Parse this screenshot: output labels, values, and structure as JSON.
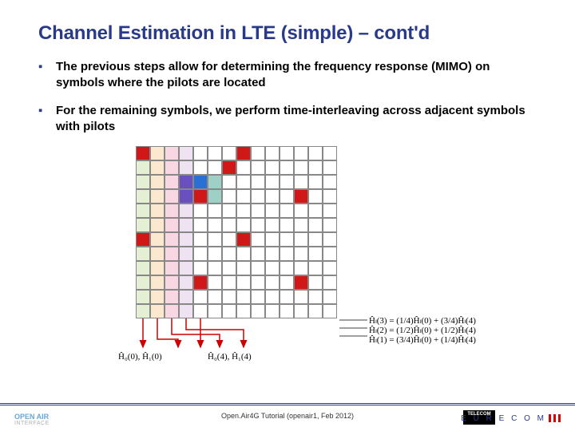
{
  "title": "Channel Estimation in LTE (simple) – cont'd",
  "bullets": [
    "The previous steps allow for determining the frequency response (MIMO) on symbols where the pilots are located",
    "For the remaining symbols, we perform time-interleaving across adjacent symbols with pilots"
  ],
  "grid": {
    "cols": 14,
    "rows": 12,
    "shaded_cols_lightpastels": true,
    "cells": [
      {
        "r": 0,
        "c": 0,
        "color": "#e4f0d4"
      },
      {
        "r": 1,
        "c": 0,
        "color": "#e4f0d4"
      },
      {
        "r": 2,
        "c": 0,
        "color": "#e4f0d4"
      },
      {
        "r": 3,
        "c": 0,
        "color": "#e4f0d4"
      },
      {
        "r": 4,
        "c": 0,
        "color": "#e4f0d4"
      },
      {
        "r": 5,
        "c": 0,
        "color": "#e4f0d4"
      },
      {
        "r": 6,
        "c": 0,
        "color": "#e4f0d4"
      },
      {
        "r": 7,
        "c": 0,
        "color": "#e4f0d4"
      },
      {
        "r": 8,
        "c": 0,
        "color": "#e4f0d4"
      },
      {
        "r": 9,
        "c": 0,
        "color": "#e4f0d4"
      },
      {
        "r": 10,
        "c": 0,
        "color": "#e4f0d4"
      },
      {
        "r": 11,
        "c": 0,
        "color": "#e4f0d4"
      },
      {
        "r": 0,
        "c": 1,
        "color": "#fbe8cf"
      },
      {
        "r": 1,
        "c": 1,
        "color": "#fbe8cf"
      },
      {
        "r": 2,
        "c": 1,
        "color": "#fbe8cf"
      },
      {
        "r": 3,
        "c": 1,
        "color": "#fbe8cf"
      },
      {
        "r": 4,
        "c": 1,
        "color": "#fbe8cf"
      },
      {
        "r": 5,
        "c": 1,
        "color": "#fbe8cf"
      },
      {
        "r": 6,
        "c": 1,
        "color": "#fbe8cf"
      },
      {
        "r": 7,
        "c": 1,
        "color": "#fbe8cf"
      },
      {
        "r": 8,
        "c": 1,
        "color": "#fbe8cf"
      },
      {
        "r": 9,
        "c": 1,
        "color": "#fbe8cf"
      },
      {
        "r": 10,
        "c": 1,
        "color": "#fbe8cf"
      },
      {
        "r": 11,
        "c": 1,
        "color": "#fbe8cf"
      },
      {
        "r": 0,
        "c": 2,
        "color": "#f9d7e2"
      },
      {
        "r": 1,
        "c": 2,
        "color": "#f9d7e2"
      },
      {
        "r": 2,
        "c": 2,
        "color": "#f9d7e2"
      },
      {
        "r": 3,
        "c": 2,
        "color": "#f9d7e2"
      },
      {
        "r": 4,
        "c": 2,
        "color": "#f9d7e2"
      },
      {
        "r": 5,
        "c": 2,
        "color": "#f9d7e2"
      },
      {
        "r": 6,
        "c": 2,
        "color": "#f9d7e2"
      },
      {
        "r": 7,
        "c": 2,
        "color": "#f9d7e2"
      },
      {
        "r": 8,
        "c": 2,
        "color": "#f9d7e2"
      },
      {
        "r": 9,
        "c": 2,
        "color": "#f9d7e2"
      },
      {
        "r": 10,
        "c": 2,
        "color": "#f9d7e2"
      },
      {
        "r": 11,
        "c": 2,
        "color": "#f9d7e2"
      },
      {
        "r": 0,
        "c": 3,
        "color": "#efe2f2"
      },
      {
        "r": 1,
        "c": 3,
        "color": "#efe2f2"
      },
      {
        "r": 2,
        "c": 3,
        "color": "#efe2f2"
      },
      {
        "r": 3,
        "c": 3,
        "color": "#efe2f2"
      },
      {
        "r": 4,
        "c": 3,
        "color": "#efe2f2"
      },
      {
        "r": 5,
        "c": 3,
        "color": "#efe2f2"
      },
      {
        "r": 6,
        "c": 3,
        "color": "#efe2f2"
      },
      {
        "r": 7,
        "c": 3,
        "color": "#efe2f2"
      },
      {
        "r": 8,
        "c": 3,
        "color": "#efe2f2"
      },
      {
        "r": 9,
        "c": 3,
        "color": "#efe2f2"
      },
      {
        "r": 10,
        "c": 3,
        "color": "#efe2f2"
      },
      {
        "r": 11,
        "c": 3,
        "color": "#efe2f2"
      },
      {
        "r": 2,
        "c": 3,
        "color": "#6a4fbf"
      },
      {
        "r": 3,
        "c": 3,
        "color": "#6a4fbf"
      },
      {
        "r": 2,
        "c": 4,
        "color": "#2a6fd6"
      },
      {
        "r": 3,
        "c": 4,
        "color": "#2a6fd6"
      },
      {
        "r": 2,
        "c": 5,
        "color": "#9fd0c6"
      },
      {
        "r": 3,
        "c": 5,
        "color": "#9fd0c6"
      },
      {
        "r": 0,
        "c": 0,
        "color": "#d01818"
      },
      {
        "r": 0,
        "c": 7,
        "color": "#d01818"
      },
      {
        "r": 3,
        "c": 4,
        "color": "#d01818",
        "over": true
      },
      {
        "r": 3,
        "c": 11,
        "color": "#d01818"
      },
      {
        "r": 6,
        "c": 0,
        "color": "#d01818"
      },
      {
        "r": 6,
        "c": 7,
        "color": "#d01818"
      },
      {
        "r": 9,
        "c": 4,
        "color": "#d01818"
      },
      {
        "r": 9,
        "c": 11,
        "color": "#d01818"
      },
      {
        "r": 1,
        "c": 6,
        "color": "#d01818"
      }
    ]
  },
  "formulas": {
    "left_bottom": "Ĥ₀(0), Ĥ₁(0)",
    "mid_bottom": "Ĥ₀(4), Ĥ₁(4)",
    "right": [
      "Ĥₗ(3) = (1/4)Ĥₗ(0) + (3/4)Ĥₗ(4)",
      "Ĥₗ(2) = (1/2)Ĥₗ(0) + (1/2)Ĥₗ(4)",
      "Ĥₗ(1) = (3/4)Ĥₗ(0) + (1/4)Ĥₗ(4)"
    ]
  },
  "footer": "Open.Air4G Tutorial (openair1, Feb 2012)",
  "logos": {
    "openair": "OPEN AIR",
    "openair_sub": "INTERFACE",
    "telecom": "TELECOM",
    "eurecom": "E U R E C O M"
  }
}
